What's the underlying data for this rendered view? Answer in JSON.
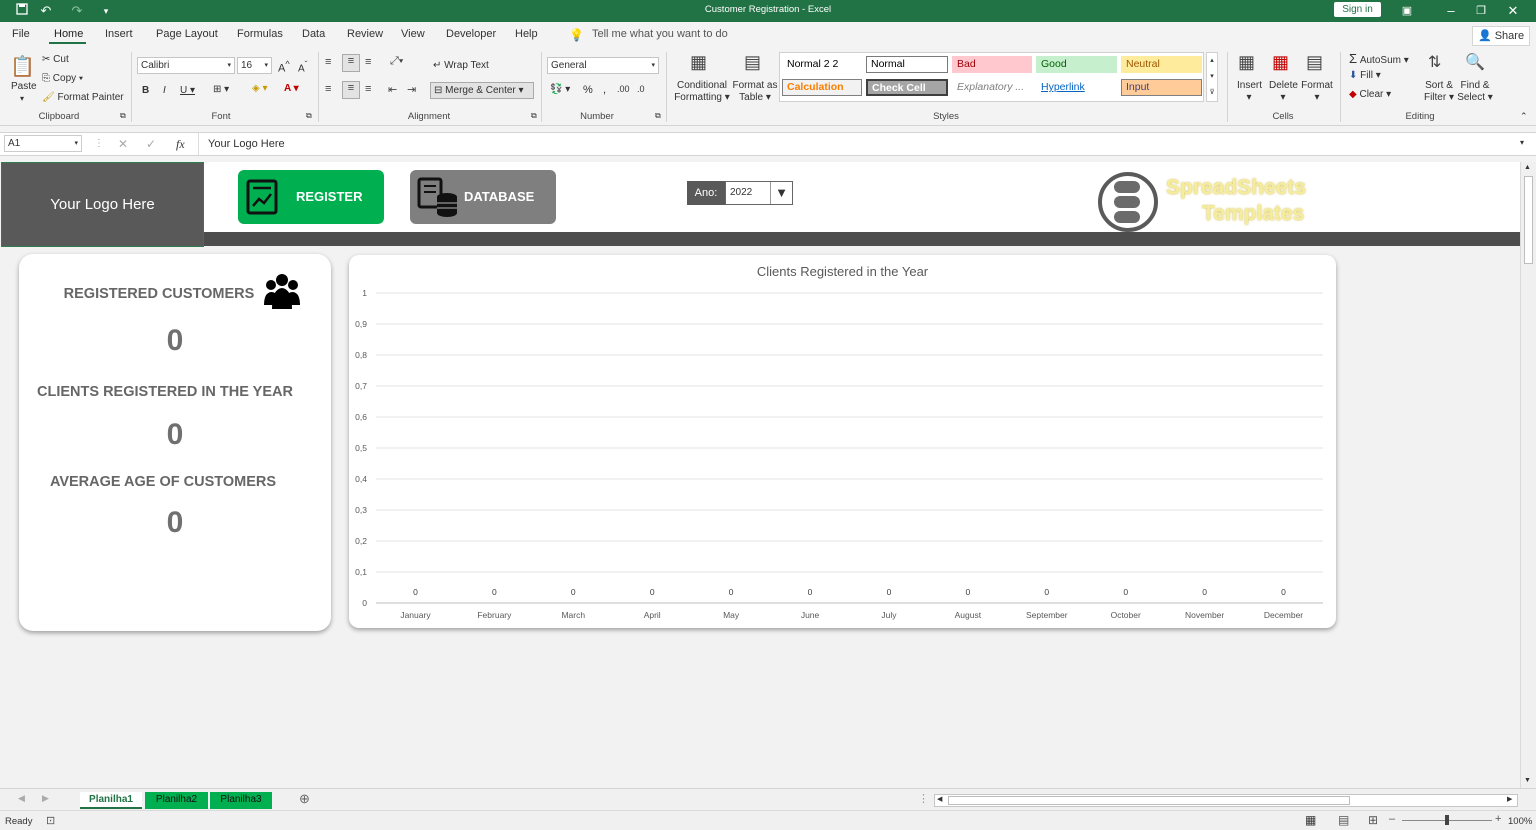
{
  "window": {
    "title": "Customer Registration  -  Excel",
    "sign_in": "Sign in",
    "share": "Share"
  },
  "ribbon_tabs": [
    "File",
    "Home",
    "Insert",
    "Page Layout",
    "Formulas",
    "Data",
    "Review",
    "View",
    "Developer",
    "Help"
  ],
  "tell_me": "Tell me what you want to do",
  "clipboard": {
    "paste": "Paste",
    "cut": "Cut",
    "copy": "Copy",
    "format_painter": "Format Painter",
    "label": "Clipboard"
  },
  "font": {
    "name": "Calibri",
    "size": "16",
    "label": "Font"
  },
  "alignment": {
    "wrap_text": "Wrap Text",
    "merge_center": "Merge & Center",
    "label": "Alignment"
  },
  "number": {
    "format": "General",
    "label": "Number"
  },
  "styles": {
    "conditional": [
      "Conditional",
      "Formatting"
    ],
    "format_table": [
      "Format as",
      "Table"
    ],
    "cells": [
      "Normal 2 2",
      "Normal",
      "Bad",
      "Good",
      "Neutral",
      "Calculation",
      "Check Cell",
      "Explanatory ...",
      "Hyperlink",
      "Input"
    ],
    "label": "Styles"
  },
  "cells_group": {
    "insert": "Insert",
    "delete": "Delete",
    "format": "Format",
    "label": "Cells"
  },
  "editing": {
    "autosum": "AutoSum",
    "fill": "Fill",
    "clear": "Clear",
    "sort": [
      "Sort &",
      "Filter"
    ],
    "find": [
      "Find &",
      "Select"
    ],
    "label": "Editing"
  },
  "formula_bar": {
    "name_box": "A1",
    "formula": "Your Logo Here"
  },
  "dashboard": {
    "logo": "Your Logo Here",
    "register": "REGISTER",
    "database": "DATABASE",
    "year_label": "Ano:",
    "year_value": "2022",
    "brand_line1": "SpreadSheets",
    "brand_line2": "Templates",
    "kpis": [
      {
        "label": "REGISTERED CUSTOMERS",
        "value": "0"
      },
      {
        "label": "CLIENTS REGISTERED IN THE YEAR",
        "value": "0"
      },
      {
        "label": "AVERAGE AGE OF CUSTOMERS",
        "value": "0"
      }
    ]
  },
  "chart_data": {
    "type": "bar",
    "title": "Clients Registered in the Year",
    "categories": [
      "January",
      "February",
      "March",
      "April",
      "May",
      "June",
      "July",
      "August",
      "September",
      "October",
      "November",
      "December"
    ],
    "values": [
      0,
      0,
      0,
      0,
      0,
      0,
      0,
      0,
      0,
      0,
      0,
      0
    ],
    "ylim": [
      0,
      1
    ],
    "yticks": [
      "0",
      "0,1",
      "0,2",
      "0,3",
      "0,4",
      "0,5",
      "0,6",
      "0,7",
      "0,8",
      "0,9",
      "1"
    ],
    "grid": true
  },
  "sheets": [
    "Planilha1",
    "Planilha2",
    "Planilha3"
  ],
  "status": {
    "ready": "Ready",
    "zoom": "100%"
  },
  "colors": {
    "excel_green": "#217346",
    "register_green": "#00b050",
    "database_gray": "#7f7f7f"
  }
}
